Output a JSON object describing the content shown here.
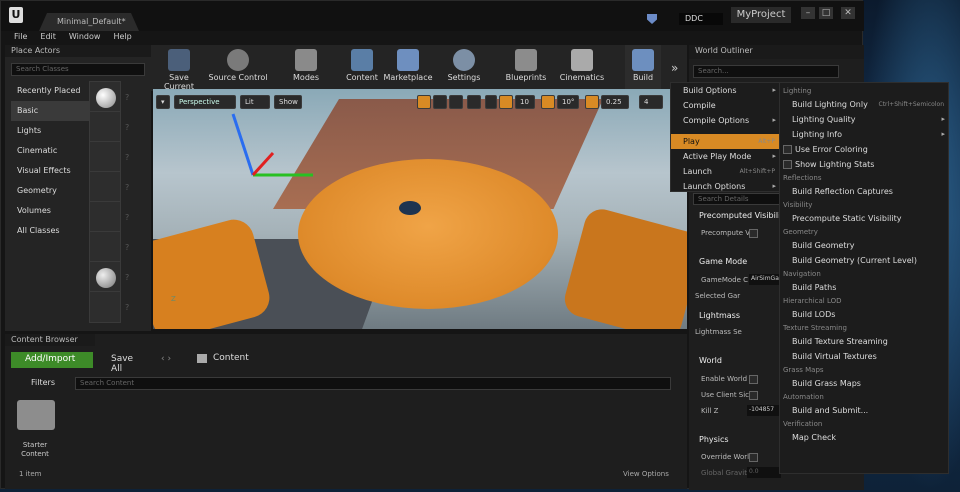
{
  "app": {
    "tab_title": "Minimal_Default*",
    "ddc_label": "DDC",
    "project_name": "MyProject",
    "logo": "U",
    "window_controls": [
      "–",
      "□",
      "✕"
    ]
  },
  "menu": [
    "File",
    "Edit",
    "Window",
    "Help"
  ],
  "place_actors": {
    "title": "Place Actors",
    "search_placeholder": "Search Classes",
    "categories": [
      "Recently Placed",
      "Basic",
      "Lights",
      "Cinematic",
      "Visual Effects",
      "Geometry",
      "Volumes",
      "All Classes"
    ],
    "help_glyph": "?"
  },
  "toolbar": {
    "buttons": [
      "Save Current",
      "Source Control",
      "Modes",
      "Content",
      "Marketplace",
      "Settings",
      "Blueprints",
      "Cinematics",
      "Build"
    ],
    "more": "»"
  },
  "viewport": {
    "perspective": "Perspective",
    "lit": "Lit",
    "show": "Show",
    "grid_snap": "10",
    "rotation_snap": "10°",
    "scale_snap": "0.25",
    "camera_speed": "4",
    "axis_label": "Z"
  },
  "play_menu": {
    "items": [
      {
        "label": "Build Options",
        "arrow": true
      },
      {
        "label": "Compile"
      },
      {
        "label": "Compile Options",
        "arrow": true
      },
      {
        "label": "Play",
        "shortcut": "Alt+P",
        "highlight": true
      },
      {
        "label": "Active Play Mode",
        "arrow": true
      },
      {
        "label": "Launch",
        "shortcut": "Alt+Shift+P"
      },
      {
        "label": "Launch Options",
        "arrow": true
      }
    ]
  },
  "build_menu": {
    "sections": [
      {
        "title": "Lighting",
        "items": [
          {
            "label": "Build Lighting Only",
            "shortcut": "Ctrl+Shift+Semicolon"
          },
          {
            "label": "Lighting Quality",
            "arrow": true
          },
          {
            "label": "Lighting Info",
            "arrow": true
          },
          {
            "label": "Use Error Coloring",
            "check": true
          },
          {
            "label": "Show Lighting Stats",
            "check": true
          }
        ]
      },
      {
        "title": "Reflections",
        "items": [
          {
            "label": "Build Reflection Captures"
          }
        ]
      },
      {
        "title": "Visibility",
        "items": [
          {
            "label": "Precompute Static Visibility"
          }
        ]
      },
      {
        "title": "Geometry",
        "items": [
          {
            "label": "Build Geometry"
          },
          {
            "label": "Build Geometry (Current Level)"
          }
        ]
      },
      {
        "title": "Navigation",
        "items": [
          {
            "label": "Build Paths"
          }
        ]
      },
      {
        "title": "Hierarchical LOD",
        "items": [
          {
            "label": "Build LODs"
          }
        ]
      },
      {
        "title": "Texture Streaming",
        "items": [
          {
            "label": "Build Texture Streaming"
          },
          {
            "label": "Build Virtual Textures"
          }
        ]
      },
      {
        "title": "Grass Maps",
        "items": [
          {
            "label": "Build Grass Maps"
          }
        ]
      },
      {
        "title": "Automation",
        "items": [
          {
            "label": "Build and Submit..."
          }
        ]
      },
      {
        "title": "Verification",
        "items": [
          {
            "label": "Map Check"
          }
        ]
      }
    ]
  },
  "outliner": {
    "title": "World Outliner",
    "search_placeholder": "Search..."
  },
  "details": {
    "search_placeholder": "Search Details",
    "precomputed": {
      "header": "Precomputed Visibili",
      "field": "Precompute V"
    },
    "game_mode": {
      "header": "Game Mode",
      "field1": "GameMode C",
      "field1_value": "AirSimGa",
      "field2": "Selected Gar"
    },
    "lightmass": {
      "header": "Lightmass",
      "field": "Lightmass Se"
    },
    "world": {
      "header": "World",
      "enable_world": "Enable World",
      "use_client": "Use Client Sic",
      "kill_z": "Kill Z",
      "kill_z_value": "-104857"
    },
    "physics": {
      "header": "Physics",
      "override": "Override Worl",
      "gravity": "Global Gravity",
      "gravity_value": "0.0"
    }
  },
  "content_browser": {
    "title": "Content Browser",
    "add_import": "Add/Import",
    "save_all": "Save All",
    "path": "Content",
    "filters": "Filters",
    "search_placeholder": "Search Content",
    "folder_line1": "Starter",
    "folder_line2": "Content",
    "item_count": "1 item",
    "view_options": "View Options"
  }
}
